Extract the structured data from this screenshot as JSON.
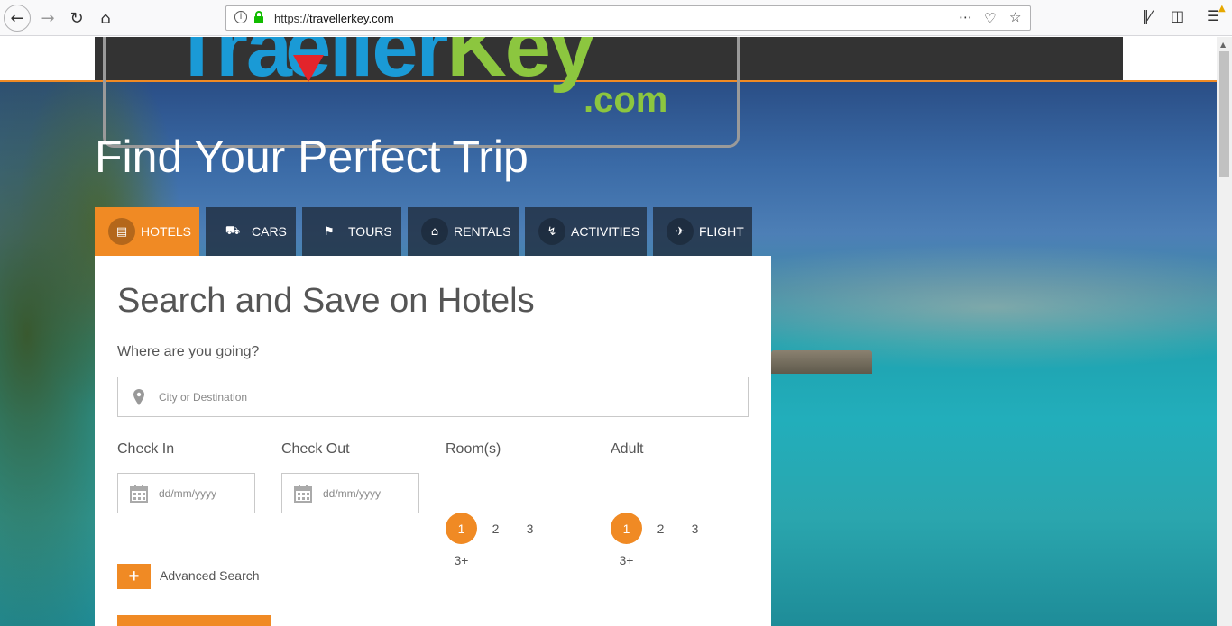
{
  "browser": {
    "url_prefix": "https://",
    "url_host": "travellerkey.com",
    "back_icon": "back-arrow-icon",
    "forward_icon": "forward-arrow-icon",
    "reload_icon": "reload-icon",
    "home_icon": "home-icon"
  },
  "site": {
    "logo_main_blue": "Tra",
    "logo_main_blue2": "eller",
    "logo_main_green": "Key",
    "logo_com": ".com",
    "hero_title": "Find Your Perfect Trip"
  },
  "tabs": [
    {
      "label": "HOTELS",
      "icon": "hotel-icon"
    },
    {
      "label": "CARS",
      "icon": "car-icon"
    },
    {
      "label": "TOURS",
      "icon": "flag-icon"
    },
    {
      "label": "RENTALS",
      "icon": "house-icon"
    },
    {
      "label": "ACTIVITIES",
      "icon": "bolt-icon"
    },
    {
      "label": "FLIGHT",
      "icon": "plane-icon"
    }
  ],
  "search": {
    "title": "Search and Save on Hotels",
    "where_label": "Where are you going?",
    "destination_placeholder": "City or Destination",
    "checkin_label": "Check In",
    "checkout_label": "Check Out",
    "date_placeholder": "dd/mm/yyyy",
    "rooms_label": "Room(s)",
    "adult_label": "Adult",
    "rooms_options": [
      "1",
      "2",
      "3",
      "3+"
    ],
    "adult_options": [
      "1",
      "2",
      "3",
      "3+"
    ],
    "rooms_selected": "1",
    "adult_selected": "1",
    "advanced_label": "Advanced Search",
    "advanced_btn": "+"
  },
  "colors": {
    "accent": "#f08a24",
    "header": "#333333",
    "logo_blue": "#1a9ad6",
    "logo_green": "#8cc63f"
  }
}
